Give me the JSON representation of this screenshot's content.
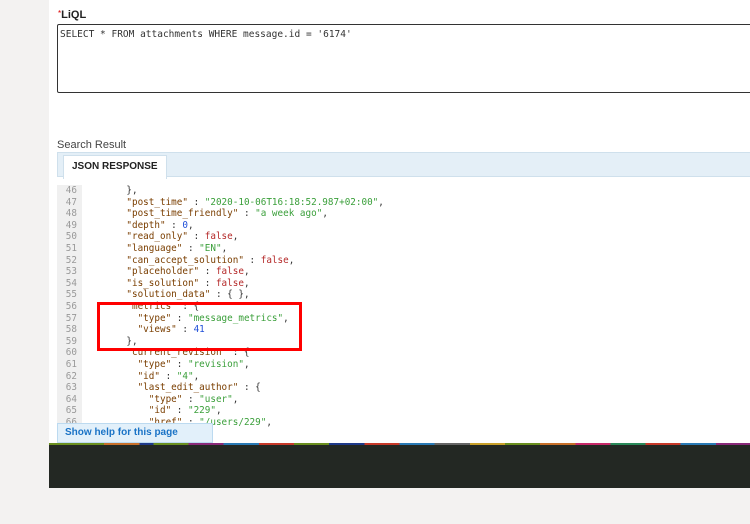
{
  "form": {
    "required_mark": "*",
    "label": "LiQL",
    "query": "SELECT * FROM attachments WHERE message.id = '6174'"
  },
  "result": {
    "heading": "Search Result",
    "tab": "JSON RESPONSE"
  },
  "code_lines": [
    {
      "num": "46",
      "tokens": [
        {
          "c": "p",
          "t": "    },"
        }
      ]
    },
    {
      "num": "47",
      "tokens": [
        {
          "c": "k",
          "t": "    \"post_time\""
        },
        {
          "c": "p",
          "t": " : "
        },
        {
          "c": "s",
          "t": "\"2020-10-06T16:18:52.987+02:00\""
        },
        {
          "c": "p",
          "t": ","
        }
      ]
    },
    {
      "num": "48",
      "tokens": [
        {
          "c": "k",
          "t": "    \"post_time_friendly\""
        },
        {
          "c": "p",
          "t": " : "
        },
        {
          "c": "s",
          "t": "\"a week ago\""
        },
        {
          "c": "p",
          "t": ","
        }
      ]
    },
    {
      "num": "49",
      "tokens": [
        {
          "c": "k",
          "t": "    \"depth\""
        },
        {
          "c": "p",
          "t": " : "
        },
        {
          "c": "n",
          "t": "0"
        },
        {
          "c": "p",
          "t": ","
        }
      ]
    },
    {
      "num": "50",
      "tokens": [
        {
          "c": "k",
          "t": "    \"read_only\""
        },
        {
          "c": "p",
          "t": " : "
        },
        {
          "c": "b",
          "t": "false"
        },
        {
          "c": "p",
          "t": ","
        }
      ]
    },
    {
      "num": "51",
      "tokens": [
        {
          "c": "k",
          "t": "    \"language\""
        },
        {
          "c": "p",
          "t": " : "
        },
        {
          "c": "s",
          "t": "\"EN\""
        },
        {
          "c": "p",
          "t": ","
        }
      ]
    },
    {
      "num": "52",
      "tokens": [
        {
          "c": "k",
          "t": "    \"can_accept_solution\""
        },
        {
          "c": "p",
          "t": " : "
        },
        {
          "c": "b",
          "t": "false"
        },
        {
          "c": "p",
          "t": ","
        }
      ]
    },
    {
      "num": "53",
      "tokens": [
        {
          "c": "k",
          "t": "    \"placeholder\""
        },
        {
          "c": "p",
          "t": " : "
        },
        {
          "c": "b",
          "t": "false"
        },
        {
          "c": "p",
          "t": ","
        }
      ]
    },
    {
      "num": "54",
      "tokens": [
        {
          "c": "k",
          "t": "    \"is_solution\""
        },
        {
          "c": "p",
          "t": " : "
        },
        {
          "c": "b",
          "t": "false"
        },
        {
          "c": "p",
          "t": ","
        }
      ]
    },
    {
      "num": "55",
      "tokens": [
        {
          "c": "k",
          "t": "    \"solution_data\""
        },
        {
          "c": "p",
          "t": " : { },"
        }
      ]
    },
    {
      "num": "56",
      "tokens": [
        {
          "c": "k",
          "t": "    \"metrics\""
        },
        {
          "c": "p",
          "t": " : {"
        }
      ]
    },
    {
      "num": "57",
      "tokens": [
        {
          "c": "k",
          "t": "      \"type\""
        },
        {
          "c": "p",
          "t": " : "
        },
        {
          "c": "s",
          "t": "\"message_metrics\""
        },
        {
          "c": "p",
          "t": ","
        }
      ]
    },
    {
      "num": "58",
      "tokens": [
        {
          "c": "k",
          "t": "      \"views\""
        },
        {
          "c": "p",
          "t": " : "
        },
        {
          "c": "n",
          "t": "41"
        }
      ]
    },
    {
      "num": "59",
      "tokens": [
        {
          "c": "p",
          "t": "    },"
        }
      ]
    },
    {
      "num": "60",
      "tokens": [
        {
          "c": "k",
          "t": "    \"current_revision\""
        },
        {
          "c": "p",
          "t": " : {"
        }
      ]
    },
    {
      "num": "61",
      "tokens": [
        {
          "c": "k",
          "t": "      \"type\""
        },
        {
          "c": "p",
          "t": " : "
        },
        {
          "c": "s",
          "t": "\"revision\""
        },
        {
          "c": "p",
          "t": ","
        }
      ]
    },
    {
      "num": "62",
      "tokens": [
        {
          "c": "k",
          "t": "      \"id\""
        },
        {
          "c": "p",
          "t": " : "
        },
        {
          "c": "s",
          "t": "\"4\""
        },
        {
          "c": "p",
          "t": ","
        }
      ]
    },
    {
      "num": "63",
      "tokens": [
        {
          "c": "k",
          "t": "      \"last_edit_author\""
        },
        {
          "c": "p",
          "t": " : {"
        }
      ]
    },
    {
      "num": "64",
      "tokens": [
        {
          "c": "k",
          "t": "        \"type\""
        },
        {
          "c": "p",
          "t": " : "
        },
        {
          "c": "s",
          "t": "\"user\""
        },
        {
          "c": "p",
          "t": ","
        }
      ]
    },
    {
      "num": "65",
      "tokens": [
        {
          "c": "k",
          "t": "        \"id\""
        },
        {
          "c": "p",
          "t": " : "
        },
        {
          "c": "s",
          "t": "\"229\""
        },
        {
          "c": "p",
          "t": ","
        }
      ]
    },
    {
      "num": "66",
      "tokens": [
        {
          "c": "k",
          "t": "        \"href\""
        },
        {
          "c": "p",
          "t": " : "
        },
        {
          "c": "s",
          "t": "\"/users/229\""
        },
        {
          "c": "p",
          "t": ","
        }
      ]
    }
  ],
  "help": {
    "label": "Show help for this page"
  },
  "highlight_color": "#ff0000"
}
